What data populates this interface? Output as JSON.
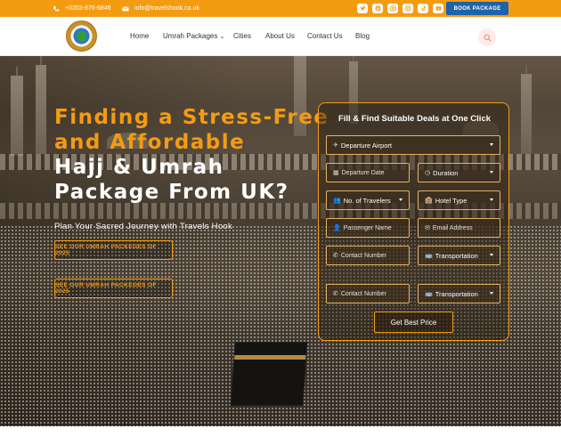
{
  "topbar": {
    "phone": "+0203-876-6846",
    "email": "info@travelshook.co.uk",
    "book_button": "BOOK PACKAGE",
    "social_icons": [
      "twitter-icon",
      "pinterest-icon",
      "instagram-icon",
      "instagram-icon",
      "tiktok-icon",
      "youtube-icon"
    ],
    "accent_color": "#f39c12",
    "button_color": "#1e63a8"
  },
  "nav": {
    "items": [
      "Home",
      "Umrah Packages",
      "Cities",
      "About Us",
      "Contact Us",
      "Blog"
    ],
    "umrah_caret": "⌄"
  },
  "hero": {
    "headline_orange_1": "Finding a Stress-Free",
    "headline_orange_2": "and Affordable",
    "headline_white_1": "Hajj & Umrah",
    "headline_white_2": "Package From UK?",
    "subtitle": "Plan Your Sacred Journey with Travels Hook",
    "cta_1": "SEE OUR UMRAH PACKEGES OF 2025",
    "cta_2": "SEE OUR UMRAH PACKEGES OF 2025"
  },
  "form": {
    "title": "Fill & Find Suitable Deals at One Click",
    "departure_airport": "Departure Airport",
    "departure_date_placeholder": "Departure Date",
    "duration": "Duration",
    "travelers": "No. of Travelers",
    "hotel_type": "Hotel Type",
    "passenger_name_placeholder": "Passenger Name",
    "email_placeholder": "Email Address",
    "contact_placeholder": "Contact Number",
    "transportation": "Transportation",
    "contact_placeholder_2": "Contact Number",
    "transportation_2": "Transportation",
    "submit": "Get Best Price"
  }
}
